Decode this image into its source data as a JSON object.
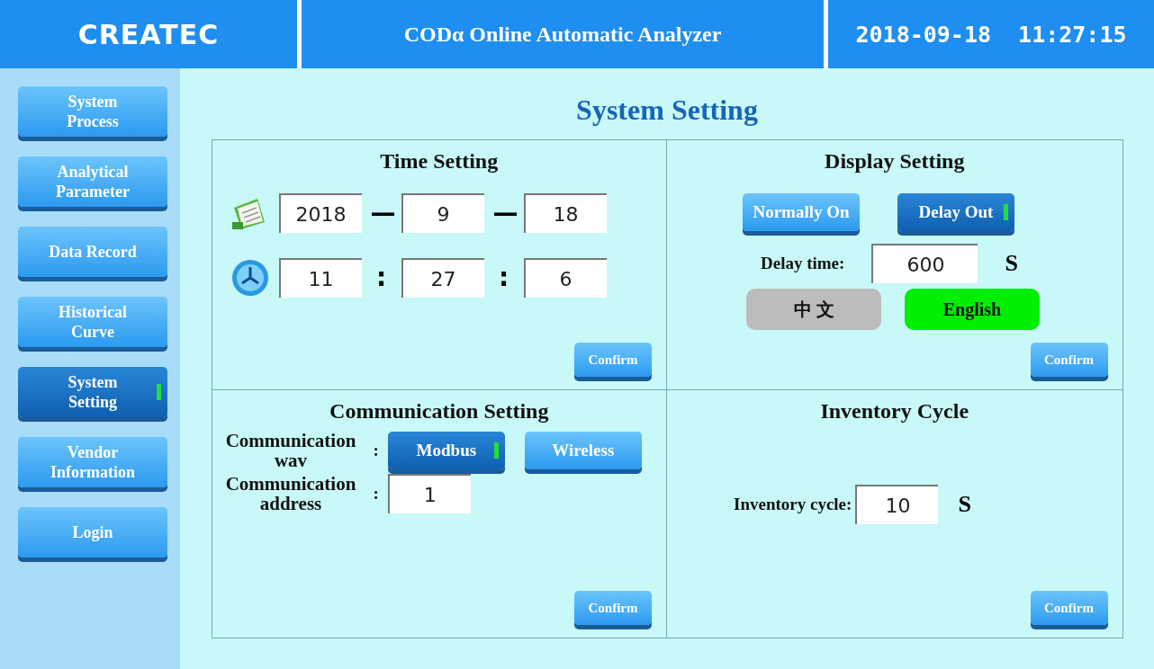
{
  "header": {
    "logo": "CREATEC",
    "title": "CODα Online Automatic Analyzer",
    "datetime": "2018-09-18  11:27:15"
  },
  "sidebar": {
    "items": [
      {
        "label": "System Process",
        "selected": false
      },
      {
        "label": "Analytical Parameter",
        "selected": false
      },
      {
        "label": "Data Record",
        "selected": false
      },
      {
        "label": "Historical Curve",
        "selected": false
      },
      {
        "label": "System Setting",
        "selected": true
      },
      {
        "label": "Vendor Information",
        "selected": false
      },
      {
        "label": "Login",
        "selected": false
      }
    ]
  },
  "page_title": "System Setting",
  "time_setting": {
    "title": "Time Setting",
    "date": [
      "2018",
      "9",
      "18"
    ],
    "date_separator": "—",
    "time": [
      "11",
      "27",
      "6"
    ],
    "time_separator": ":",
    "confirm": "Confirm"
  },
  "display_setting": {
    "title": "Display Setting",
    "modes": [
      {
        "label": "Normally On",
        "selected": false
      },
      {
        "label": "Delay Out",
        "selected": true
      }
    ],
    "delay_label": "Delay time:",
    "delay_value": "600",
    "delay_unit": "S",
    "languages": [
      {
        "label": "中 文",
        "selected": false
      },
      {
        "label": "English",
        "selected": true
      }
    ],
    "confirm": "Confirm"
  },
  "communication_setting": {
    "title": "Communication Setting",
    "way_label": "Communication wav",
    "ways": [
      {
        "label": "Modbus",
        "selected": true
      },
      {
        "label": "Wireless",
        "selected": false
      }
    ],
    "address_label": "Communication address",
    "address_value": "1",
    "colon": ":",
    "confirm": "Confirm"
  },
  "inventory_cycle": {
    "title": "Inventory Cycle",
    "label": "Inventory cycle:",
    "value": "10",
    "unit": "S",
    "confirm": "Confirm"
  }
}
